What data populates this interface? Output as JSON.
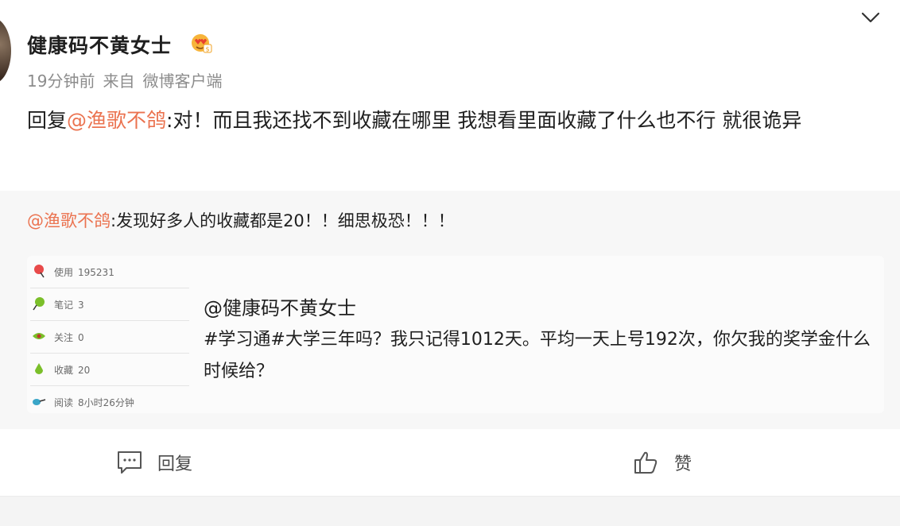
{
  "post": {
    "username": "健康码不黄女士",
    "time": "19分钟前",
    "source_prefix": "来自",
    "source": "微博客户端",
    "reply_prefix": "回复",
    "reply_mention": "@渔歌不鸽",
    "reply_body": ":对！而且我还找不到收藏在哪里 我想看里面收藏了什么也不行 就很诡异"
  },
  "quote": {
    "mention": "@渔歌不鸽",
    "text": ":发现好多人的收藏都是20！！细思极恐！！！",
    "card": {
      "stats": [
        {
          "label": "使用",
          "value": "195231",
          "icon": "pin-icon",
          "color": "#e84a4a"
        },
        {
          "label": "笔记",
          "value": "3",
          "icon": "racket-icon",
          "color": "#7bbf2a"
        },
        {
          "label": "关注",
          "value": "0",
          "icon": "leaf-icon",
          "color": "#7bbf2a"
        },
        {
          "label": "收藏",
          "value": "20",
          "icon": "pear-icon",
          "color": "#7bbf2a"
        },
        {
          "label": "阅读",
          "value": "8小时26分钟",
          "icon": "glasses-icon",
          "color": "#3aa6c8"
        }
      ],
      "title": "@健康码不黄女士",
      "body": "#学习通#大学三年吗？我只记得1012天。平均一天上号192次，你欠我的奖学金什么时候给？"
    }
  },
  "actions": {
    "reply_label": "回复",
    "like_label": "赞"
  },
  "colors": {
    "mention": "#eb7350",
    "quote_bg": "#f7f7f7",
    "text": "#1f1f1f",
    "meta": "#8c8c8c"
  }
}
